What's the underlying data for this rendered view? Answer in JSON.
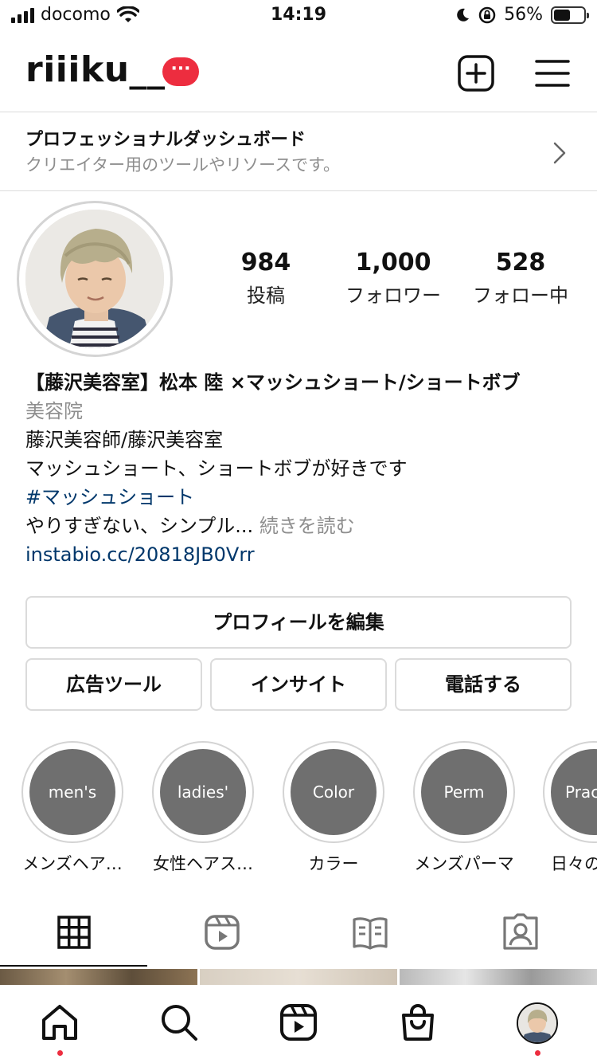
{
  "status_bar": {
    "carrier": "docomo",
    "time": "14:19",
    "battery": "56%",
    "battery_level": 0.56,
    "icons": [
      "signal-icon",
      "wifi-icon",
      "moon-icon",
      "rotation-lock-icon",
      "battery-icon"
    ]
  },
  "header": {
    "username": "riiiku__",
    "badge": "···",
    "icons": [
      "new-post-icon",
      "menu-icon"
    ]
  },
  "dashboard": {
    "title": "プロフェッショナルダッシュボード",
    "subtitle": "クリエイター用のツールやリソースです。"
  },
  "profile": {
    "stats": [
      {
        "value": "984",
        "label": "投稿"
      },
      {
        "value": "1,000",
        "label": "フォロワー"
      },
      {
        "value": "528",
        "label": "フォロー中"
      }
    ],
    "name": "【藤沢美容室】松本 陸 ×マッシュショート/ショートボブ",
    "category": "美容院",
    "bio_line1": "藤沢美容師/藤沢美容室",
    "bio_line2": "マッシュショート、ショートボブが好きです",
    "hashtag": "#マッシュショート",
    "bio_line3": "やりすぎない、シンプル...",
    "more_label": "続きを読む",
    "link": "instabio.cc/20818JB0Vrr"
  },
  "buttons": {
    "edit": "プロフィールを編集",
    "ads": "広告ツール",
    "insights": "インサイト",
    "call": "電話する"
  },
  "highlights": [
    {
      "cover": "men's",
      "label": "メンズヘア…"
    },
    {
      "cover": "ladies'",
      "label": "女性ヘアス…"
    },
    {
      "cover": "Color",
      "label": "カラー"
    },
    {
      "cover": "Perm",
      "label": "メンズパーマ"
    },
    {
      "cover": "Prac",
      "label": "日々の"
    }
  ],
  "tabs": [
    "grid-icon",
    "reels-icon",
    "guides-icon",
    "tagged-icon"
  ],
  "bottom_nav": [
    "home-icon",
    "search-icon",
    "reels-icon",
    "shop-icon",
    "profile-avatar"
  ],
  "colors": {
    "badge_red": "#ed2d3f",
    "link_blue": "#00376b",
    "muted_gray": "#8e8e8e",
    "border": "#dbdbdb"
  }
}
